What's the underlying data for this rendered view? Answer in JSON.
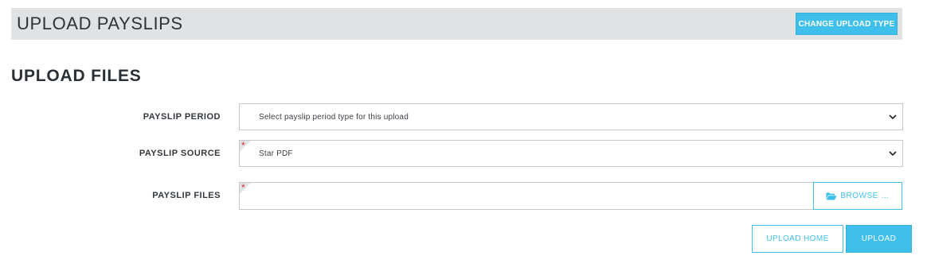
{
  "header": {
    "title": "UPLOAD PAYSLIPS",
    "change_type_label": "CHANGE UPLOAD TYPE"
  },
  "section": {
    "title": "UPLOAD FILES"
  },
  "form": {
    "period": {
      "label": "PAYSLIP PERIOD",
      "value": "Select payslip period type for this upload",
      "required": false
    },
    "source": {
      "label": "PAYSLIP SOURCE",
      "value": "Star PDF",
      "required": true
    },
    "files": {
      "label": "PAYSLIP FILES",
      "value": "",
      "required": true,
      "browse_label": "BROWSE …"
    },
    "required_marker": "*"
  },
  "actions": {
    "home_label": "UPLOAD HOME",
    "upload_label": "UPLOAD"
  },
  "icons": {
    "chevron": "chevron-down-icon",
    "folder": "folder-open-icon"
  },
  "colors": {
    "accent": "#3fc0ec",
    "header_bg": "#e1e2e3",
    "required": "#d33030"
  }
}
